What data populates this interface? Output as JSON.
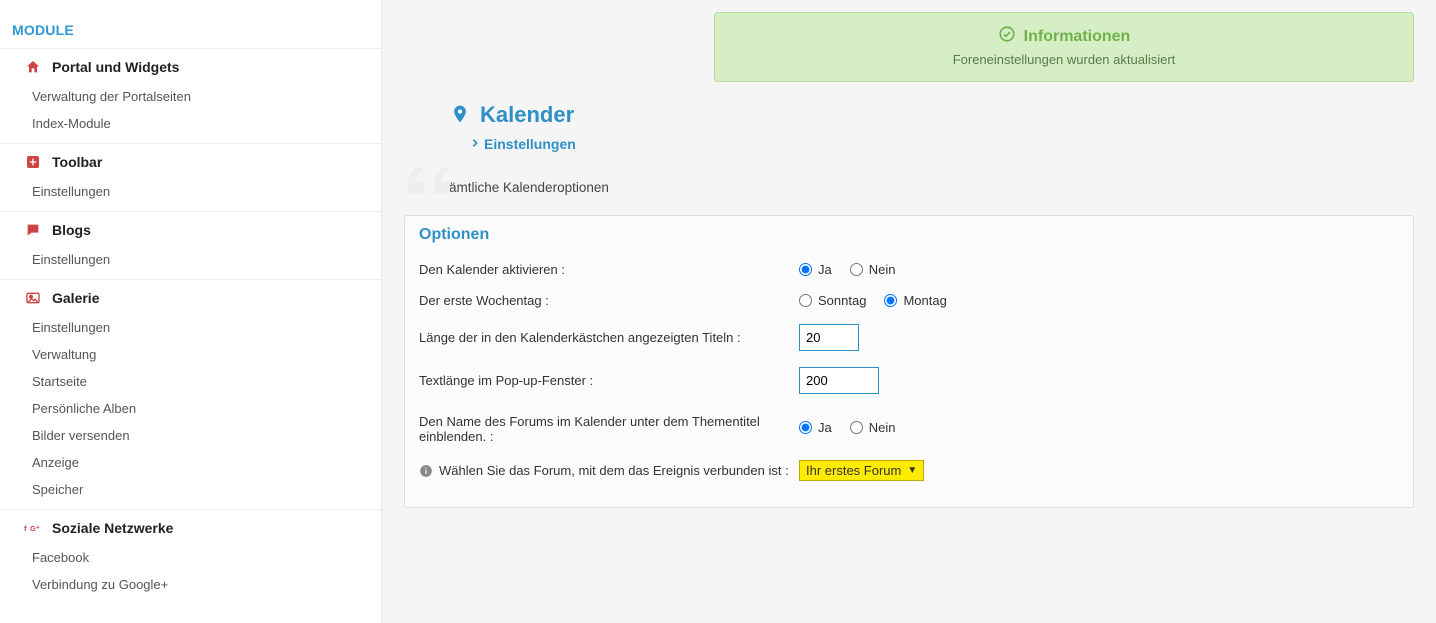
{
  "sidebar": {
    "module_label": "MODULE",
    "groups": [
      {
        "icon": "home-icon",
        "title": "Portal und Widgets",
        "items": [
          "Verwaltung der Portalseiten",
          "Index-Module"
        ]
      },
      {
        "icon": "plus-square-icon",
        "title": "Toolbar",
        "items": [
          "Einstellungen"
        ]
      },
      {
        "icon": "comment-icon",
        "title": "Blogs",
        "items": [
          "Einstellungen"
        ]
      },
      {
        "icon": "image-icon",
        "title": "Galerie",
        "items": [
          "Einstellungen",
          "Verwaltung",
          "Startseite",
          "Persönliche Alben",
          "Bilder versenden",
          "Anzeige",
          "Speicher"
        ]
      },
      {
        "icon": "social-icon",
        "title": "Soziale Netzwerke",
        "items": [
          "Facebook",
          "Verbindung zu Google+"
        ]
      }
    ]
  },
  "alert": {
    "title": "Informationen",
    "message": "Foreneinstellungen wurden aktualisiert"
  },
  "page": {
    "title": "Kalender",
    "subnav": "Einstellungen",
    "quote": "Sämtliche Kalenderoptionen"
  },
  "panel": {
    "title": "Optionen",
    "rows": {
      "activate": {
        "label": "Den Kalender aktivieren :",
        "opt_yes": "Ja",
        "opt_no": "Nein",
        "value": "Ja"
      },
      "first_day": {
        "label": "Der erste Wochentag :",
        "opt_a": "Sonntag",
        "opt_b": "Montag",
        "value": "Montag"
      },
      "title_len": {
        "label": "Länge der in den Kalenderkästchen angezeigten Titeln :",
        "value": "20"
      },
      "popup_len": {
        "label": "Textlänge im Pop-up-Fenster :",
        "value": "200"
      },
      "show_forum_name": {
        "label": "Den Name des Forums im Kalender unter dem Thementitel einblenden. :",
        "opt_yes": "Ja",
        "opt_no": "Nein",
        "value": "Ja"
      },
      "select_forum": {
        "label": "Wählen Sie das Forum, mit dem das Ereignis verbunden ist :",
        "selected": "Ihr erstes Forum"
      }
    }
  }
}
